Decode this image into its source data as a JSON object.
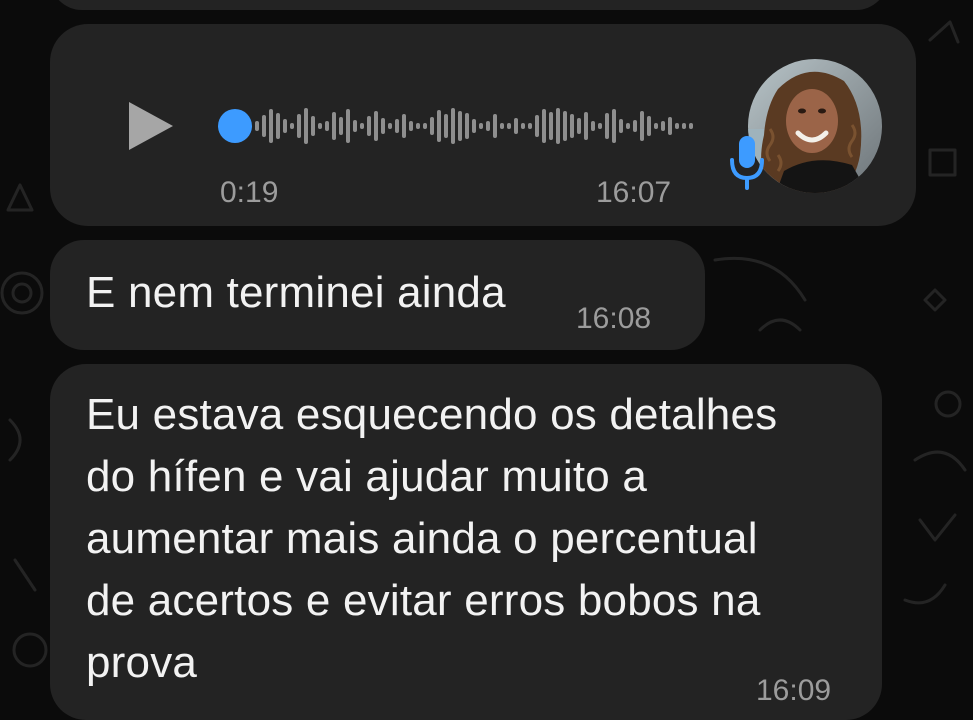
{
  "conversation": {
    "voice_message": {
      "duration": "0:19",
      "time": "16:07",
      "progress": 0.0,
      "icons": {
        "play": "play-icon",
        "mic": "microphone-icon",
        "avatar": "contact-avatar"
      },
      "colors": {
        "progress_dot": "#3d9bff",
        "mic": "#3d9bff",
        "waveform": "#8e8e8e"
      }
    },
    "messages": [
      {
        "text": "E nem terminei ainda",
        "time": "16:08"
      },
      {
        "lines": [
          "Eu estava esquecendo os detalhes",
          "do hífen e vai ajudar muito a",
          "aumentar mais ainda o percentual",
          "de acertos e evitar erros bobos na",
          "prova"
        ],
        "time": "16:09"
      }
    ]
  },
  "theme": {
    "background": "#0b0b0b",
    "bubble": "#232323",
    "text": "#f2f2f2",
    "timestamp": "#9c9c9c"
  }
}
